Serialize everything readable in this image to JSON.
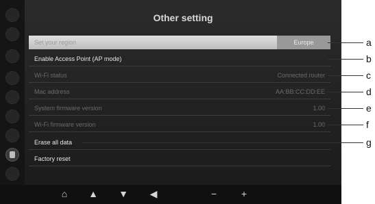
{
  "screen": {
    "title": "Other setting"
  },
  "settings": {
    "region": {
      "label": "Set your region",
      "value": "Europe"
    },
    "access_point": {
      "label": "Enable Access Point (AP mode)"
    },
    "wifi_status": {
      "label": "Wi-Fi status",
      "value": "Connected router"
    },
    "mac_address": {
      "label": "Mac address",
      "value": "AA:BB:CC:DD:EE"
    },
    "system_firmware": {
      "label": "System firmware version",
      "value": "1.00"
    },
    "wifi_firmware": {
      "label": "Wi-Fi firmware version",
      "value": "1.00"
    },
    "erase_all": {
      "label": "Erase all data"
    },
    "factory_reset": {
      "label": "Factory reset"
    }
  },
  "callouts": [
    "a",
    "b",
    "c",
    "d",
    "e",
    "f",
    "g"
  ],
  "bottom_nav": {
    "home": "⌂",
    "up": "▲",
    "down": "▼",
    "back": "◀",
    "minus": "−",
    "plus": "+"
  }
}
